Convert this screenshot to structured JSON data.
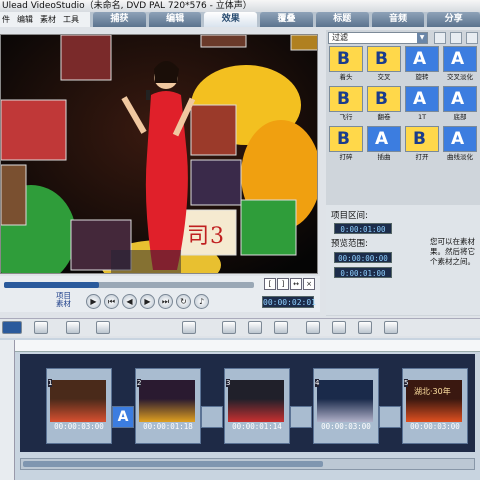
{
  "window": {
    "title": "Ulead VideoStudio（未命名, DVD PAL 720*576 - 立体声）"
  },
  "menu": [
    "件",
    "编辑",
    "素材",
    "工具"
  ],
  "steps": [
    {
      "label": "捕获",
      "active": false
    },
    {
      "label": "编辑",
      "active": false
    },
    {
      "label": "效果",
      "active": true
    },
    {
      "label": "覆叠",
      "active": false
    },
    {
      "label": "标题",
      "active": false
    },
    {
      "label": "音频",
      "active": false
    },
    {
      "label": "分享",
      "active": false
    }
  ],
  "transport": {
    "mode_labels": [
      "项目",
      "素材"
    ],
    "buttons": [
      "play-icon",
      "home-icon",
      "prev-frame-icon",
      "next-frame-icon",
      "end-icon",
      "repeat-icon",
      "volume-icon"
    ],
    "timecode": "00:00:02:01",
    "progress": 0.38,
    "marker_buttons": [
      "[",
      "]",
      "↔",
      "×"
    ]
  },
  "library": {
    "filter_label": "过滤",
    "effects": [
      {
        "label": "着头",
        "letter": "B",
        "bg": "#ffd84a",
        "fg": "#1a3c8c"
      },
      {
        "label": "交叉",
        "letter": "B",
        "bg": "#ffd84a",
        "fg": "#1a3c8c"
      },
      {
        "label": "旋转",
        "letter": "A",
        "bg": "#3c7de0",
        "fg": "#ffffff"
      },
      {
        "label": "交叉淡化",
        "letter": "A",
        "bg": "#3c7de0",
        "fg": "#ffffff"
      },
      {
        "label": "飞行",
        "letter": "B",
        "bg": "#ffd84a",
        "fg": "#1a3c8c"
      },
      {
        "label": "翻卷",
        "letter": "B",
        "bg": "#ffd84a",
        "fg": "#1a3c8c"
      },
      {
        "label": "1T",
        "letter": "A",
        "bg": "#3c7de0",
        "fg": "#ffffff"
      },
      {
        "label": "底部",
        "letter": "A",
        "bg": "#3c7de0",
        "fg": "#ffffff"
      },
      {
        "label": "打碎",
        "letter": "B",
        "bg": "#ffd84a",
        "fg": "#1a3c8c"
      },
      {
        "label": "插曲",
        "letter": "A",
        "bg": "#3c7de0",
        "fg": "#ffffff"
      },
      {
        "label": "打开",
        "letter": "B",
        "bg": "#ffd84a",
        "fg": "#1a3c8c"
      },
      {
        "label": "曲线淡化",
        "letter": "A",
        "bg": "#3c7de0",
        "fg": "#ffffff"
      }
    ]
  },
  "info": {
    "project_range_label": "项目区间:",
    "project_range_value": "0:00:01:00",
    "preview_range_label": "预览范围:",
    "preview_start": "00:00:00:00",
    "preview_end": "0:00:01:00",
    "hint": "您可以在素材果。然后将它个素材之间。"
  },
  "timeline": {
    "clips": [
      {
        "num": "1",
        "duration": "00:00:03:00"
      },
      {
        "num": "2",
        "duration": "00:00:01:18"
      },
      {
        "num": "3",
        "duration": "00:00:01:14"
      },
      {
        "num": "4",
        "duration": "00:00:03:00"
      },
      {
        "num": "5",
        "duration": "00:00:03:00"
      }
    ],
    "clip_labels": [
      "",
      "",
      "",
      "",
      "湖北·30年"
    ]
  },
  "colors": {
    "accent": "#2a5a9c",
    "tab_active": "#25496e"
  }
}
